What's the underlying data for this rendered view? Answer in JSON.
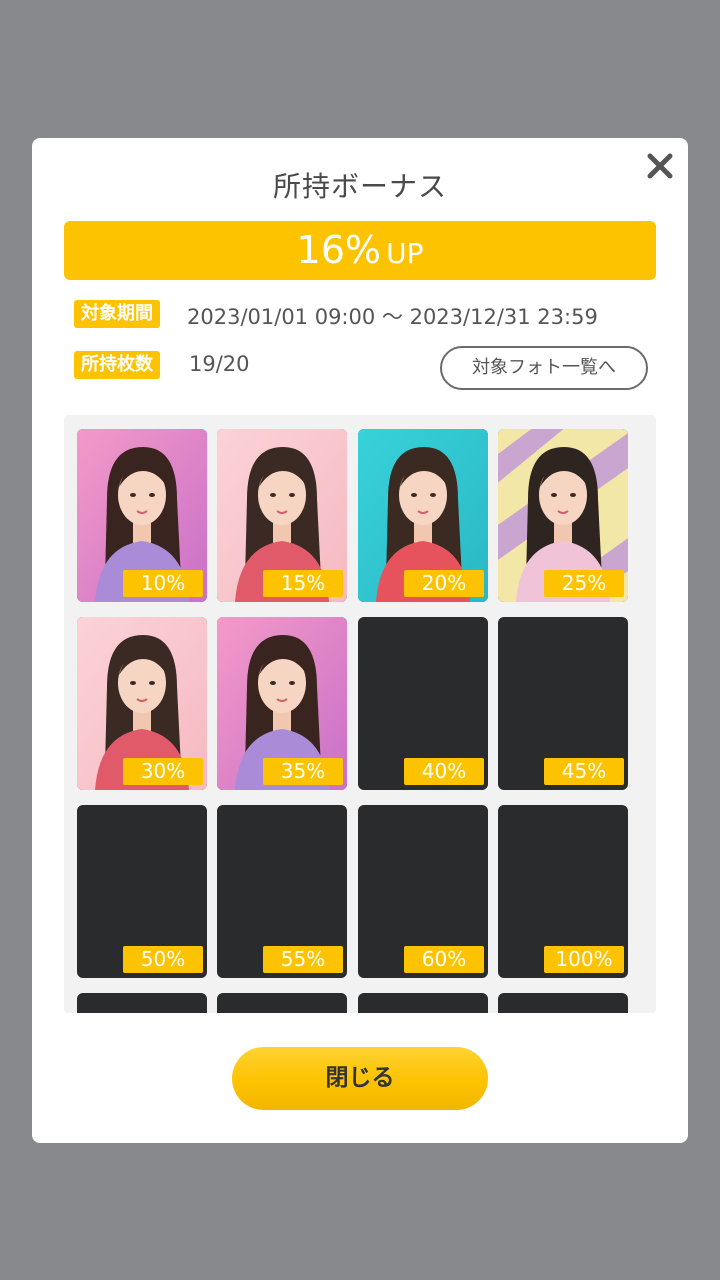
{
  "dialog": {
    "title": "所持ボーナス",
    "bonus_value": "16%",
    "bonus_suffix": "UP",
    "period_label": "対象期間",
    "period_value": "2023/01/01 09:00 ～ 2023/12/31 23:59",
    "count_label": "所持枚数",
    "count_value": "19/20",
    "photo_list_button": "対象フォト一覧へ",
    "close_button": "閉じる"
  },
  "colors": {
    "accent": "#fdc300",
    "overlay": "#88898d",
    "locked_card": "#2a2b2d"
  },
  "cards": [
    {
      "percent": "10%",
      "owned": true,
      "theme": "pink-sparkle"
    },
    {
      "percent": "15%",
      "owned": true,
      "theme": "pink"
    },
    {
      "percent": "20%",
      "owned": true,
      "theme": "teal"
    },
    {
      "percent": "25%",
      "owned": true,
      "theme": "stripes"
    },
    {
      "percent": "30%",
      "owned": true,
      "theme": "pink"
    },
    {
      "percent": "35%",
      "owned": true,
      "theme": "pink-sparkle"
    },
    {
      "percent": "40%",
      "owned": false
    },
    {
      "percent": "45%",
      "owned": false
    },
    {
      "percent": "50%",
      "owned": false
    },
    {
      "percent": "55%",
      "owned": false
    },
    {
      "percent": "60%",
      "owned": false
    },
    {
      "percent": "100%",
      "owned": false
    },
    {
      "percent": "",
      "owned": false
    },
    {
      "percent": "",
      "owned": false
    },
    {
      "percent": "",
      "owned": false
    },
    {
      "percent": "",
      "owned": false
    }
  ]
}
